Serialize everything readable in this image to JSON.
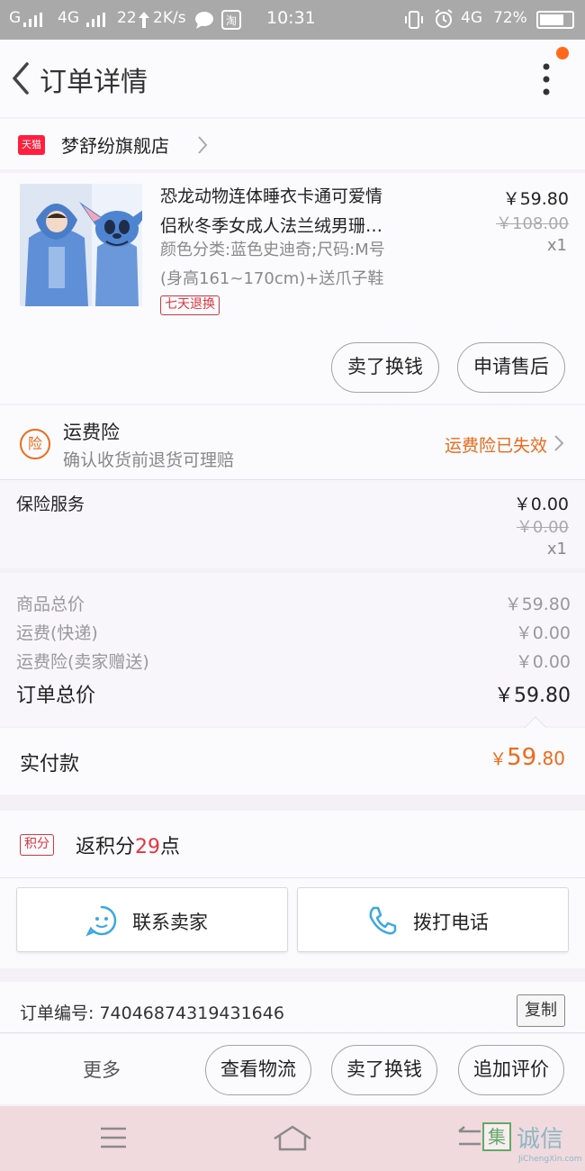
{
  "status_bar": {
    "carrier": "G",
    "network1": "4G",
    "notif_count": "22",
    "speed": "2K/s",
    "time": "10:31",
    "network2": "4G",
    "battery": "72%"
  },
  "header": {
    "title": "订单详情"
  },
  "store": {
    "badge": "天猫",
    "name": "梦舒纷旗舰店"
  },
  "product": {
    "title_line1": "恐龙动物连体睡衣卡通可爱情",
    "title_line2": "侣秋冬季女成人法兰绒男珊…",
    "attr_line1": "颜色分类:蓝色史迪奇;尺码:M号",
    "attr_line2": "(身高161~170cm)+送爪子鞋",
    "return_badge": "七天退换",
    "price": "￥59.80",
    "original_price": "￥108.00",
    "quantity": "x1"
  },
  "product_actions": {
    "sell_label": "卖了换钱",
    "after_sale_label": "申请售后"
  },
  "insurance": {
    "icon_text": "险",
    "title": "运费险",
    "subtitle": "确认收货前退货可理赔",
    "status": "运费险已失效"
  },
  "service": {
    "label": "保险服务",
    "price": "￥0.00",
    "original_price": "￥0.00",
    "quantity": "x1"
  },
  "summary": {
    "goods_label": "商品总价",
    "goods_value": "￥59.80",
    "shipping_label": "运费(快递)",
    "shipping_value": "￥0.00",
    "insurance_label": "运费险(卖家赠送)",
    "insurance_value": "￥0.00",
    "total_label": "订单总价",
    "total_value": "￥59.80"
  },
  "paid": {
    "label": "实付款",
    "currency": "￥",
    "amount": "59",
    "cents": ".80"
  },
  "points": {
    "badge": "积分",
    "prefix": "返积分",
    "value": "29",
    "suffix": "点"
  },
  "contact": {
    "seller_label": "联系卖家",
    "phone_label": "拨打电话"
  },
  "order": {
    "number_text": "订单编号: 74046874319431646",
    "copy_label": "复制"
  },
  "bottom_actions": {
    "more_label": "更多",
    "logistics_label": "查看物流",
    "sell_label": "卖了换钱",
    "review_label": "追加评价"
  },
  "watermark": {
    "mark": "集",
    "text": "诚信",
    "sub": "JiChengXin.com"
  },
  "colors": {
    "accent_orange": "#f06a1a",
    "tmall_red": "#ff1f3e",
    "badge_red": "#e8343d"
  }
}
